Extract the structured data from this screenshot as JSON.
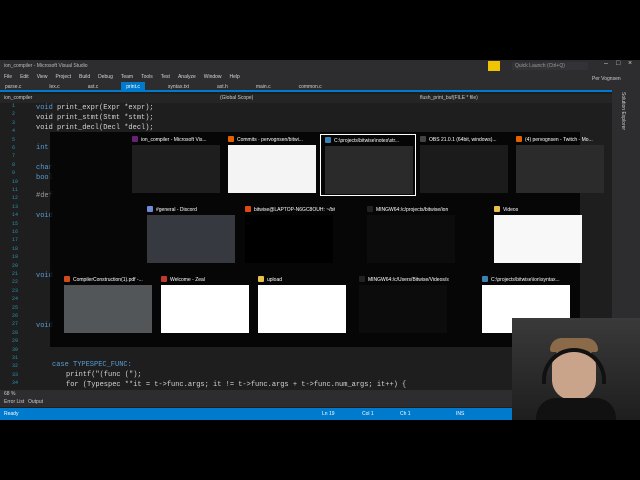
{
  "window": {
    "title": "ion_compiler - Microsoft Visual Studio",
    "quick_launch": "Quick Launch (Ctrl+Q)",
    "user": "Per Vognsen"
  },
  "menu": [
    "File",
    "Edit",
    "View",
    "Project",
    "Build",
    "Debug",
    "Team",
    "Tools",
    "Test",
    "Analyze",
    "Window",
    "Help"
  ],
  "tabs": [
    "parse.c",
    "lex.c",
    "ast.c",
    "print.c",
    "syntax.txt",
    "ast.h",
    "main.c",
    "common.c"
  ],
  "navbar": {
    "project": "ion_compiler",
    "scope": "(Global Scope)",
    "member": "flush_print_buf(FILE * file)"
  },
  "code": {
    "l1": "void print_expr(Expr *expr);",
    "l2": "void print_stmt(Stmt *stmt);",
    "l3": "void print_decl(Decl *decl);",
    "l5": "int",
    "l7": "char",
    "l8": "bool",
    "l10": "#def",
    "l12": "void",
    "tail1": "case TYPESPEC_FUNC:",
    "tail2": "printf(\"(func (\");",
    "tail3": "for (Typespec **it = t->func.args; it != t->func.args + t->func.num_args; it++) {",
    "tail4": "printf(\" \");"
  },
  "line_numbers": [
    "1",
    "2",
    "3",
    "4",
    "5",
    "6",
    "7",
    "8",
    "9",
    "10",
    "11",
    "12",
    "13",
    "14",
    "15",
    "16",
    "17",
    "18",
    "19",
    "20",
    "21",
    "22",
    "23",
    "24",
    "25",
    "26",
    "27",
    "28",
    "29",
    "30",
    "31",
    "32",
    "33",
    "34"
  ],
  "zoom": "68 %",
  "bottom_tabs": [
    "Error List",
    "Output"
  ],
  "status": {
    "ready": "Ready",
    "ln": "Ln 19",
    "col": "Col 1",
    "ch": "Ch 1",
    "ins": "INS"
  },
  "right_rail": "Solution Explorer",
  "task_switcher": [
    {
      "title": "ion_compiler - Microsoft Vis...",
      "icon": "visual-studio-icon",
      "color": "#68217a"
    },
    {
      "title": "Commits · pervognsen/bitwi...",
      "icon": "firefox-icon",
      "color": "#e66000"
    },
    {
      "title": "C:\\projects\\bitwise\\notes\\str...",
      "icon": "notepad-icon",
      "color": "#3c7fb1"
    },
    {
      "title": "OBS 21.0.1 (64bit, windows)...",
      "icon": "obs-icon",
      "color": "#444444"
    },
    {
      "title": "(4) pervognsen - Twitch - Mo...",
      "icon": "firefox-icon",
      "color": "#e66000"
    },
    {
      "title": "#general - Discord",
      "icon": "discord-icon",
      "color": "#7289da"
    },
    {
      "title": "bitwise@LAPTOP-N6GC8OUH: ~/bitwise/...",
      "icon": "ubuntu-icon",
      "color": "#dd4814"
    },
    {
      "title": "MINGW64:/c/projects/bitwise/ion",
      "icon": "terminal-icon",
      "color": "#222222"
    },
    {
      "title": "Videos",
      "icon": "folder-icon",
      "color": "#e8c14a"
    },
    {
      "title": "CompilerConstruction(1).pdf -...",
      "icon": "pdf-icon",
      "color": "#d04a1a"
    },
    {
      "title": "Welcome - Zeal",
      "icon": "zeal-icon",
      "color": "#c0392b"
    },
    {
      "title": "upload",
      "icon": "folder-icon",
      "color": "#e8c14a"
    },
    {
      "title": "MINGW64:/c/Users/Bitwise/Videos/streams",
      "icon": "terminal-icon",
      "color": "#222222"
    },
    {
      "title": "C:\\projects\\bitwise\\ion\\syntax...",
      "icon": "notepad-icon",
      "color": "#3c7fb1"
    }
  ]
}
